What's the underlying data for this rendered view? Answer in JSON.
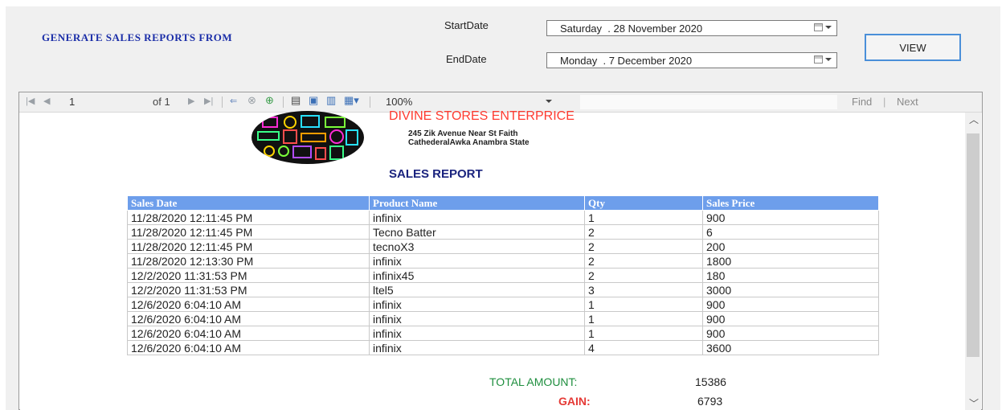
{
  "header": {
    "title": "GENERATE SALES REPORTS FROM",
    "start_label": "StartDate",
    "end_label": "EndDate",
    "start_day": "Saturday",
    "start_date": ". 28 November 2020",
    "end_day": "Monday",
    "end_date": ". 7 December 2020",
    "view_button": "VIEW"
  },
  "toolbar": {
    "page": "1",
    "of_pages": "of 1",
    "zoom": "100%",
    "find": "Find",
    "separator": "|",
    "next": "Next"
  },
  "report": {
    "company": "DIVINE STORES ENTERPRICE",
    "address_line1": "245 Zik Avenue Near St Faith",
    "address_line2": "CathederalAwka Anambra State",
    "title": "SALES REPORT",
    "columns": [
      "Sales Date",
      "Product Name",
      "Qty",
      "Sales Price"
    ],
    "rows": [
      [
        "11/28/2020 12:11:45 PM",
        "infinix",
        "1",
        "900"
      ],
      [
        "11/28/2020 12:11:45 PM",
        "Tecno Batter",
        "2",
        "6"
      ],
      [
        "11/28/2020 12:11:45 PM",
        "tecnoX3",
        "2",
        "200"
      ],
      [
        "11/28/2020 12:13:30 PM",
        "infinix",
        "2",
        "1800"
      ],
      [
        "12/2/2020 11:31:53 PM",
        "infinix45",
        "2",
        "180"
      ],
      [
        "12/2/2020 11:31:53 PM",
        "ltel5",
        "3",
        "3000"
      ],
      [
        "12/6/2020 6:04:10 AM",
        "infinix",
        "1",
        "900"
      ],
      [
        "12/6/2020 6:04:10 AM",
        "infinix",
        "1",
        "900"
      ],
      [
        "12/6/2020 6:04:10 AM",
        "infinix",
        "1",
        "900"
      ],
      [
        "12/6/2020 6:04:10 AM",
        "infinix",
        "4",
        "3600"
      ]
    ],
    "total_label": "TOTAL AMOUNT:",
    "total_value": "15386",
    "gain_label": "GAIN:",
    "gain_value": "6793"
  },
  "colors": {
    "title_blue": "#1b2ea8",
    "header_fill": "#6d9eeb",
    "company_red": "#ff3b30",
    "total_green": "#1e8e3e",
    "gain_red": "#e53935",
    "button_border": "#4a8fd9"
  }
}
